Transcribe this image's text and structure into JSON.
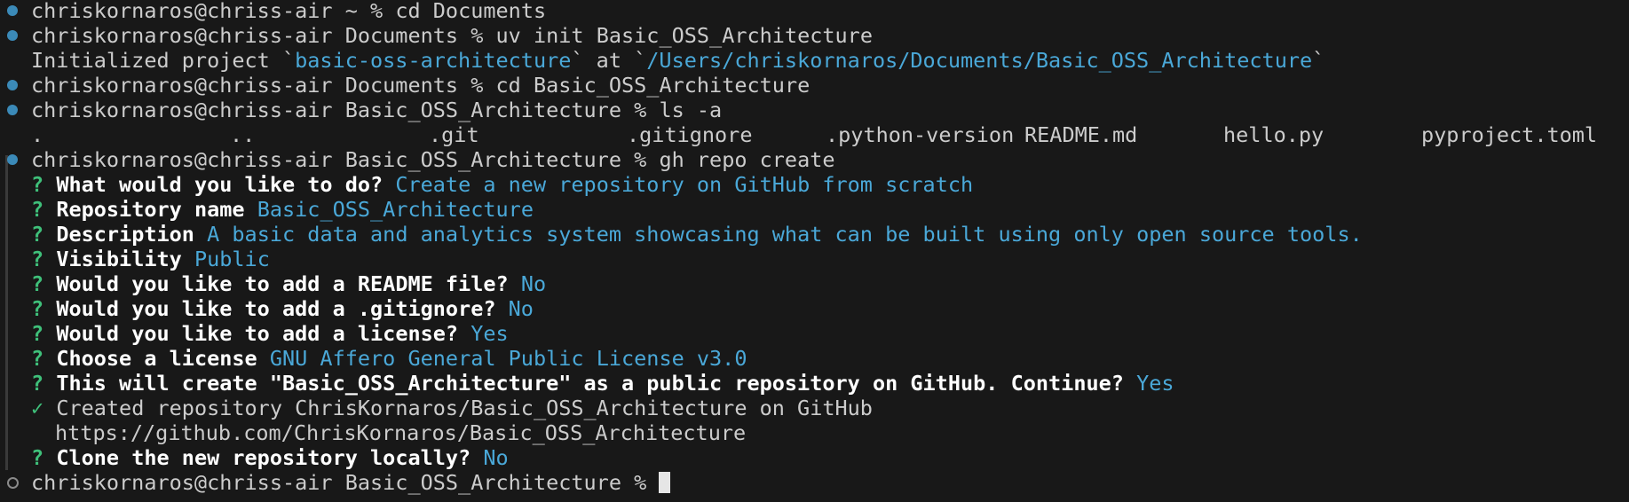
{
  "prompt": {
    "host": "chriskornaros@chriss-air",
    "dir_home": "~",
    "dir_docs": "Documents",
    "dir_proj": "Basic_OSS_Architecture",
    "symbol": "%"
  },
  "commands": {
    "cd_docs": "cd Documents",
    "uv_init": "uv init Basic_OSS_Architecture",
    "cd_proj": "cd Basic_OSS_Architecture",
    "ls": "ls -a",
    "gh": "gh repo create"
  },
  "uv_output": {
    "prefix": "Initialized project `",
    "project": "basic-oss-architecture",
    "mid": "` at `",
    "path": "/Users/chriskornaros/Documents/Basic_OSS_Architecture",
    "suffix": "`"
  },
  "ls_output": [
    ".",
    "..",
    ".git",
    ".gitignore",
    ".python-version",
    "README.md",
    "hello.py",
    "pyproject.toml"
  ],
  "gh_prompts": [
    {
      "q": "What would you like to do?",
      "a": "Create a new repository on GitHub from scratch"
    },
    {
      "q": "Repository name",
      "a": "Basic_OSS_Architecture"
    },
    {
      "q": "Description",
      "a": "A basic data and analytics system showcasing what can be built using only open source tools."
    },
    {
      "q": "Visibility",
      "a": "Public"
    },
    {
      "q": "Would you like to add a README file?",
      "a": "No"
    },
    {
      "q": "Would you like to add a .gitignore?",
      "a": "No"
    },
    {
      "q": "Would you like to add a license?",
      "a": "Yes"
    },
    {
      "q": "Choose a license",
      "a": "GNU Affero General Public License v3.0"
    },
    {
      "q": "This will create \"Basic_OSS_Architecture\" as a public repository on GitHub. Continue?",
      "a": "Yes"
    }
  ],
  "gh_result": {
    "mark": "✓",
    "created": "Created repository ChrisKornaros/Basic_OSS_Architecture on GitHub",
    "url": "https://github.com/ChrisKornaros/Basic_OSS_Architecture"
  },
  "gh_clone": {
    "q": "Clone the new repository locally?",
    "a": "No"
  },
  "glyphs": {
    "question": "?"
  },
  "colors": {
    "background": "#181818",
    "text": "#cccccc",
    "accent": "#4aa8d8",
    "question_mark": "#3fc07a",
    "status_dot": "#3b8ab8"
  }
}
